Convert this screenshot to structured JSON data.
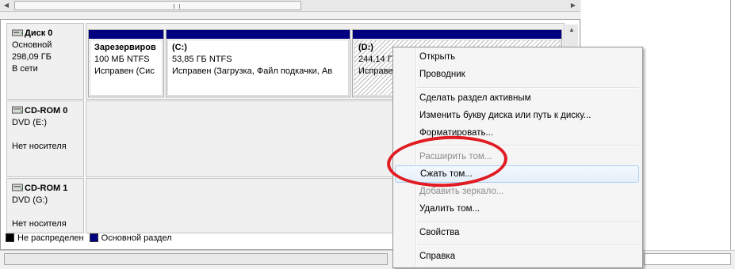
{
  "colors": {
    "primary_partition": "#000080",
    "unallocated": "#000000",
    "annotation": "#e11b22",
    "disabled_text": "#8d8d8d"
  },
  "disks": [
    {
      "name": "Диск 0",
      "type": "Основной",
      "size": "298,09 ГБ",
      "status": "В сети",
      "icon": "hard-disk-icon"
    },
    {
      "name": "CD-ROM 0",
      "type": "DVD (E:)",
      "status": "Нет носителя",
      "icon": "cdrom-icon"
    },
    {
      "name": "CD-ROM 1",
      "type": "DVD (G:)",
      "status": "Нет носителя",
      "icon": "cdrom-icon"
    }
  ],
  "volumes": [
    {
      "name": "Зарезервиров",
      "size": "100 МБ NTFS",
      "status": "Исправен (Сис"
    },
    {
      "name": "(C:)",
      "size": "53,85 ГБ NTFS",
      "status": "Исправен (Загрузка, Файл подкачки, Ав"
    },
    {
      "name": "(D:)",
      "size": "244,14 ГБ NTFS",
      "status": "Исправен"
    }
  ],
  "legend": [
    {
      "label": "Не распределен",
      "color": "#000000"
    },
    {
      "label": "Основной раздел",
      "color": "#000080"
    }
  ],
  "context_menu": {
    "open": "Открыть",
    "explorer": "Проводник",
    "mark_active": "Сделать раздел активным",
    "change_letter": "Изменить букву диска или путь к диску...",
    "format": "Форматировать...",
    "extend": "Расширить том...",
    "shrink": "Сжать том...",
    "add_mirror": "Добавить зеркало...",
    "delete": "Удалить том...",
    "properties": "Свойства",
    "help": "Справка"
  }
}
